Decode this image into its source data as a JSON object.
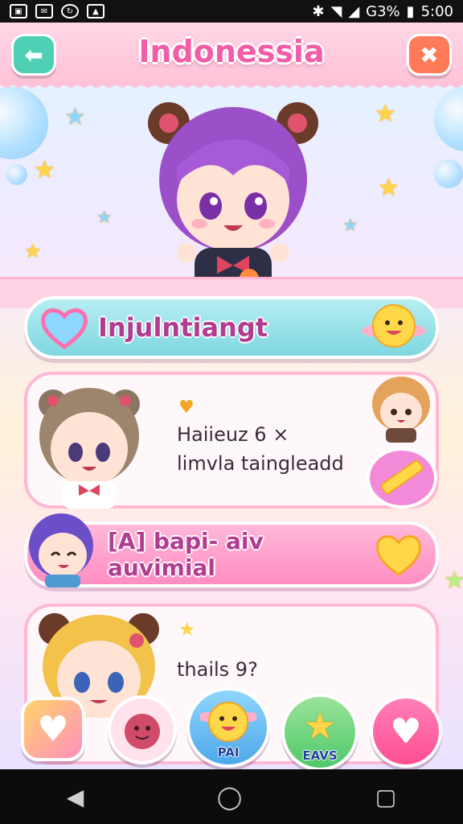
{
  "status_bar": {
    "battery_text": "G3%",
    "time": "5:00"
  },
  "header": {
    "title": "Indonessia",
    "back_icon": "arrow-left-icon",
    "close_icon": "close-icon"
  },
  "menu": {
    "top_button": {
      "label": "Injulntiangt"
    },
    "info_card_1": {
      "line1": "Haiieuz 6 ×",
      "line2": "limvla taingleadd"
    },
    "pink_button": {
      "label": "[A] bapi- aiv auvimial"
    },
    "info_card_2": {
      "line1": "thails 9?"
    }
  },
  "dock": {
    "item3_label": "PAI",
    "item4_label": "EAVS"
  },
  "colors": {
    "title_pink": "#f35ca7",
    "teal": "#4fd0b5",
    "orange": "#ff7a59"
  }
}
